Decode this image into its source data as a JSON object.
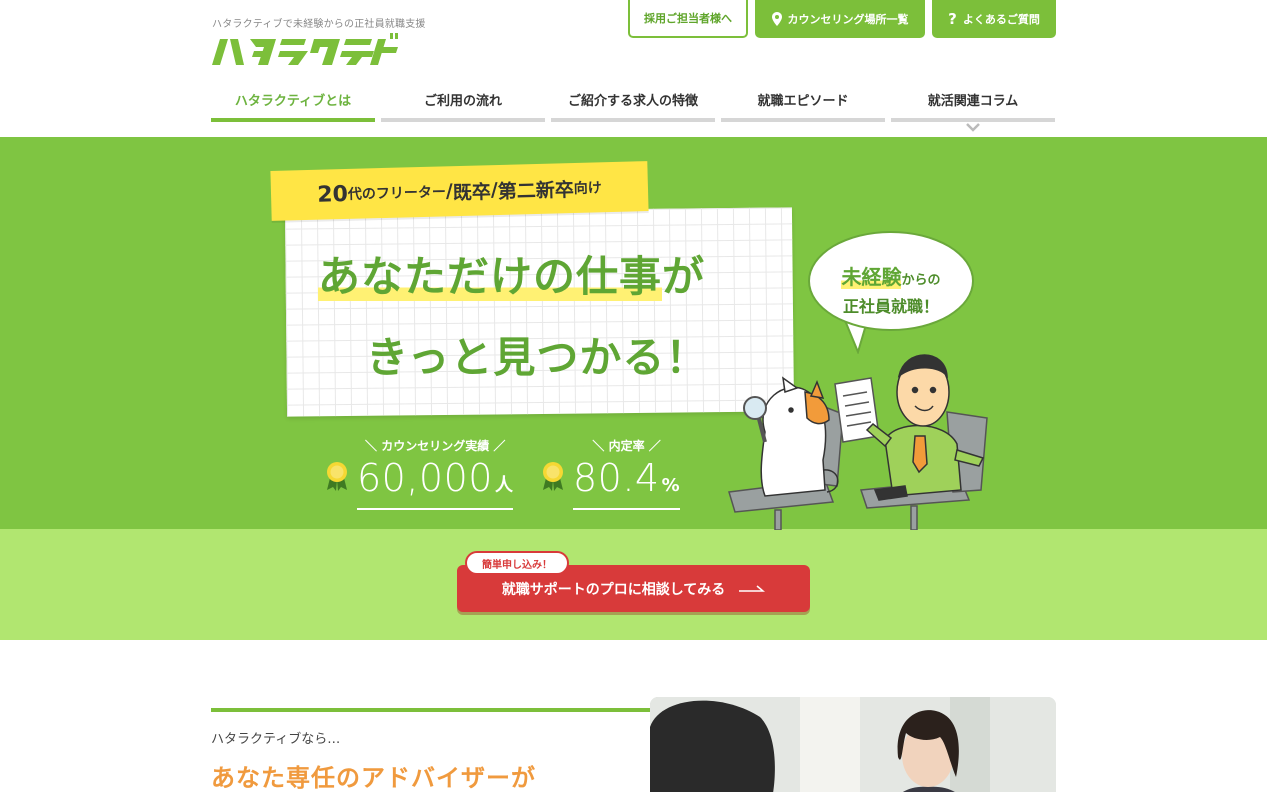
{
  "header": {
    "tagline": "ハタラクティブで未経験からの正社員就職支援",
    "logo_text": "ハタラクティブ",
    "top_buttons": [
      {
        "label": "採用ご担当者様へ",
        "icon": ""
      },
      {
        "label": "カウンセリング場所一覧",
        "icon": "location-pin-icon"
      },
      {
        "label": "よくあるご質問",
        "icon": "question-icon"
      }
    ],
    "nav": [
      {
        "label": "ハタラクティブとは",
        "active": true
      },
      {
        "label": "ご利用の流れ",
        "active": false
      },
      {
        "label": "ご紹介する求人の特徴",
        "active": false
      },
      {
        "label": "就職エピソード",
        "active": false
      },
      {
        "label": "就活関連コラム",
        "active": false
      }
    ]
  },
  "hero": {
    "target": {
      "num": "20",
      "part1": "代のフリーター",
      "sep": "/",
      "part2": "既卒",
      "part3": "第二新卒",
      "part4": "向け"
    },
    "headline1_a": "あなただけの仕事",
    "headline1_b": "が",
    "headline2": "きっと見つかる！",
    "bubble": {
      "em": "未経験",
      "small": "からの",
      "line2": "正社員就職！"
    },
    "stats": [
      {
        "label": "カウンセリング実績",
        "value": "60,000",
        "unit": "人"
      },
      {
        "label": "内定率",
        "value": "80.4",
        "unit": "%"
      }
    ]
  },
  "cta": {
    "badge": "簡単申し込み！",
    "label": "就職サポートのプロに相談してみる"
  },
  "intro": {
    "sub": "ハタラクティブなら…",
    "heading": "あなた専任のアドバイザーが"
  },
  "colors": {
    "brand_green": "#7cbf3a",
    "hero_bg": "#7fc542",
    "cta_band": "#b1e670",
    "cta_red": "#d83a3a",
    "accent_orange": "#f09a3e",
    "ribbon_yellow": "#ffe545"
  }
}
